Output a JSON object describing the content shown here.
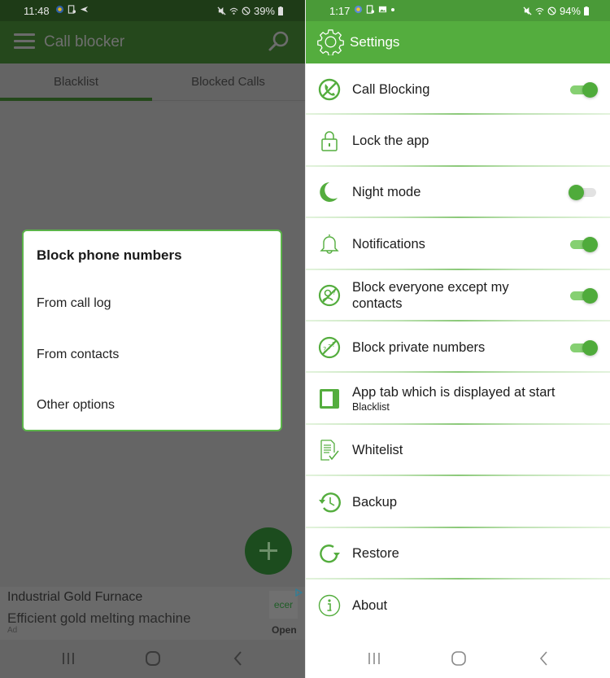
{
  "left_screen": {
    "status_bar": {
      "time": "11:48",
      "battery": "39%"
    },
    "toolbar": {
      "title": "Call blocker",
      "menu_icon": "hamburger-menu-icon",
      "search_icon": "search-icon"
    },
    "tabs": [
      {
        "label": "Blacklist",
        "selected": true
      },
      {
        "label": "Blocked Calls",
        "selected": false
      }
    ],
    "dialog": {
      "title": "Block phone numbers",
      "options": [
        "From call log",
        "From contacts",
        "Other options"
      ]
    },
    "fab": {
      "icon": "plus-icon"
    },
    "ad": {
      "title": "Industrial Gold Furnace",
      "description": "Efficient gold melting machine",
      "label": "Ad",
      "logo_text": "ecer",
      "cta": "Open"
    }
  },
  "right_screen": {
    "status_bar": {
      "time": "1:17",
      "battery": "94%"
    },
    "toolbar": {
      "title": "Settings",
      "icon": "gear-icon"
    },
    "settings": [
      {
        "key": "call-blocking",
        "label": "Call Blocking",
        "icon": "blocked-phone-icon",
        "toggle": true,
        "on": true
      },
      {
        "key": "lock-app",
        "label": "Lock the app",
        "icon": "lock-icon",
        "toggle": false
      },
      {
        "key": "night-mode",
        "label": "Night mode",
        "icon": "moon-icon",
        "toggle": true,
        "on": false
      },
      {
        "key": "notifications",
        "label": "Notifications",
        "icon": "bell-icon",
        "toggle": true,
        "on": true
      },
      {
        "key": "block-except-contacts",
        "label": "Block everyone except my contacts",
        "icon": "blocked-contact-icon",
        "toggle": true,
        "on": true
      },
      {
        "key": "block-private",
        "label": "Block private numbers",
        "icon": "blocked-private-number-icon",
        "toggle": true,
        "on": true
      },
      {
        "key": "start-tab",
        "label": "App tab which is displayed at start",
        "sublabel": "Blacklist",
        "icon": "window-tab-icon",
        "toggle": false
      },
      {
        "key": "whitelist",
        "label": "Whitelist",
        "icon": "checked-document-icon",
        "toggle": false
      },
      {
        "key": "backup",
        "label": "Backup",
        "icon": "history-clock-icon",
        "toggle": false
      },
      {
        "key": "restore",
        "label": "Restore",
        "icon": "refresh-icon",
        "toggle": false
      },
      {
        "key": "about",
        "label": "About",
        "icon": "info-icon",
        "toggle": false
      }
    ]
  },
  "colors": {
    "primary_green": "#54ad3e",
    "status_green": "#4a9a38",
    "toggle_thumb": "#4fab3b",
    "toggle_track_on": "#86d072",
    "toggle_track_off": "#e2e2e2",
    "dim_overlay": "#656565"
  }
}
